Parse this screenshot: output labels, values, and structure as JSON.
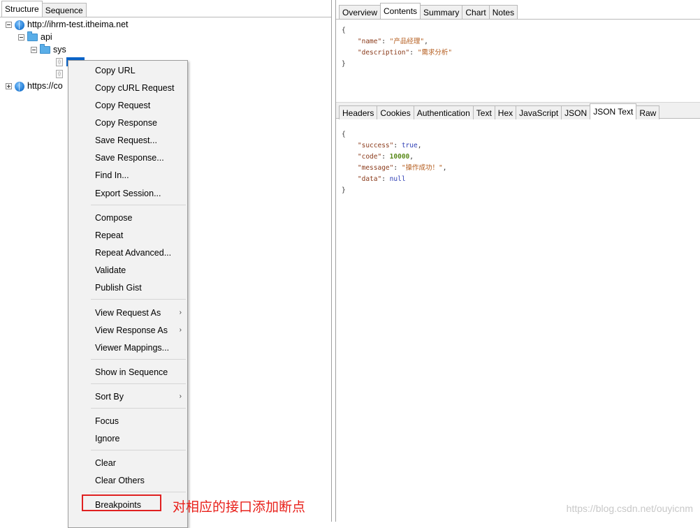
{
  "left_tabs": [
    "Structure",
    "Sequence"
  ],
  "tree": {
    "host1": "http://ihrm-test.itheima.net",
    "folder_api": "api",
    "folder_sys": "sys",
    "host2": "https://co"
  },
  "context_menu": {
    "items": [
      "Copy URL",
      "Copy cURL Request",
      "Copy Request",
      "Copy Response",
      "Save Request...",
      "Save Response...",
      "Find In...",
      "Export Session...",
      "Compose",
      "Repeat",
      "Repeat Advanced...",
      "Validate",
      "Publish Gist",
      "View Request As",
      "View Response As",
      "Viewer Mappings...",
      "Show in Sequence",
      "Sort By",
      "Focus",
      "Ignore",
      "Clear",
      "Clear Others",
      "Breakpoints"
    ],
    "submenu_arrow": "›"
  },
  "annotation": "对相应的接口添加断点",
  "top_tabs": [
    "Overview",
    "Contents",
    "Summary",
    "Chart",
    "Notes"
  ],
  "request_body": {
    "open": "{",
    "name_key": "\"name\"",
    "name_value": "\"产品经理\"",
    "desc_key": "\"description\"",
    "desc_value": "\"需求分析\"",
    "close": "}"
  },
  "response_tabs": [
    "Headers",
    "Cookies",
    "Authentication",
    "Text",
    "Hex",
    "JavaScript",
    "JSON",
    "JSON Text",
    "Raw"
  ],
  "response_body": {
    "open": "{",
    "success_key": "\"success\"",
    "success_value": "true",
    "code_key": "\"code\"",
    "code_value": "10000",
    "message_key": "\"message\"",
    "message_value": "\"操作成功！\"",
    "data_key": "\"data\"",
    "data_value": "null",
    "close": "}"
  },
  "watermark": "https://blog.csdn.net/ouyicnm"
}
